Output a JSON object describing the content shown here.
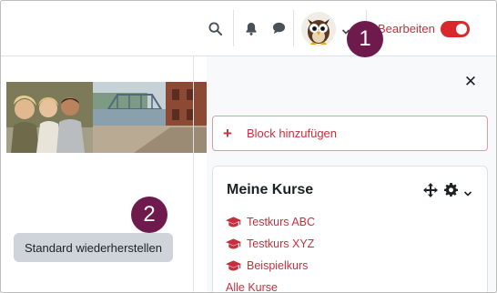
{
  "navbar": {
    "edit_label": "Bearbeiten",
    "edit_mode_on": true
  },
  "callouts": {
    "first": "1",
    "second": "2"
  },
  "main": {
    "restore_label": "Standard wiederherstellen"
  },
  "drawer": {
    "add_block_label": "Block hinzufügen",
    "block_title": "Meine Kurse",
    "courses": [
      "Testkurs ABC",
      "Testkurs XYZ",
      "Beispielkurs"
    ],
    "partial_link": "Alle Kurse"
  },
  "colors": {
    "accent": "#c6303e",
    "callout": "#6e1a4d",
    "toggle": "#d9272e"
  }
}
